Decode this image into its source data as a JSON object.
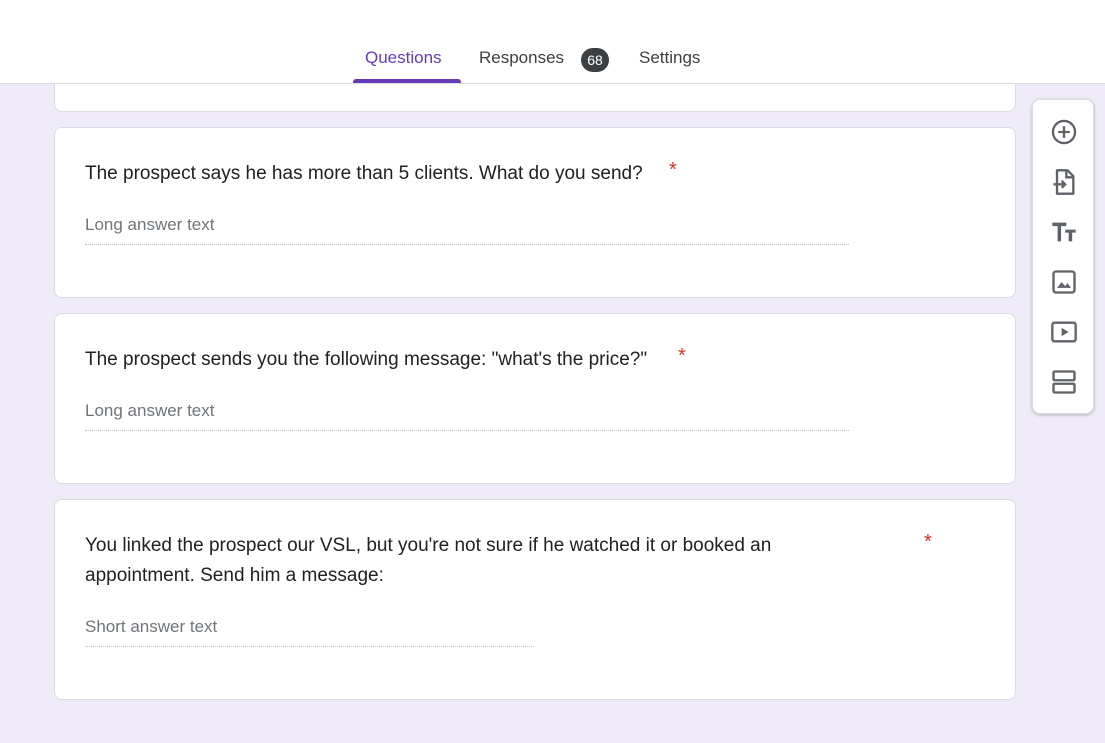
{
  "tabs": {
    "questions": "Questions",
    "responses": "Responses",
    "responses_count": "68",
    "settings": "Settings"
  },
  "questions": [
    {
      "title": "The prospect says he has more than 5 clients. What do you send?",
      "required": "*",
      "placeholder": "Long answer text"
    },
    {
      "title": "The prospect sends you the following message: \"what's the price?\"",
      "required": "*",
      "placeholder": "Long answer text"
    },
    {
      "title_line1": "You linked the prospect our VSL, but you're not sure if he watched it or booked an",
      "title_line2": "appointment. Send him a message:",
      "required": "*",
      "placeholder": "Short answer text"
    }
  ],
  "toolbar": [
    {
      "icon": "add-circle-icon"
    },
    {
      "icon": "import-questions-icon"
    },
    {
      "icon": "title-text-icon"
    },
    {
      "icon": "image-icon"
    },
    {
      "icon": "video-icon"
    },
    {
      "icon": "section-icon"
    }
  ],
  "colors": {
    "accent": "#673ab7",
    "background": "#f0ebf8",
    "required": "#d93025"
  }
}
